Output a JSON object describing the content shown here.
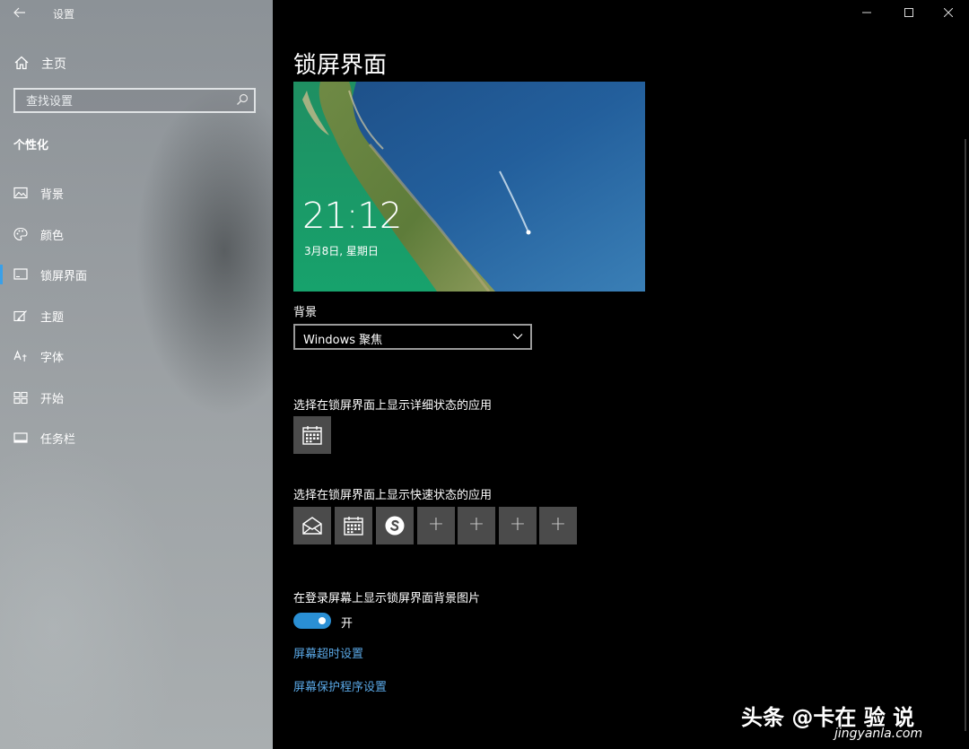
{
  "window": {
    "title": "设置",
    "controls": [
      "minimize-icon",
      "maximize-icon",
      "close-icon"
    ]
  },
  "sidebar": {
    "home_label": "主页",
    "search": {
      "placeholder": "查找设置"
    },
    "section_title": "个性化",
    "items": [
      {
        "label": "背景",
        "icon": "picture-icon",
        "selected": false
      },
      {
        "label": "颜色",
        "icon": "palette-icon",
        "selected": false
      },
      {
        "label": "锁屏界面",
        "icon": "lock-screen-icon",
        "selected": true
      },
      {
        "label": "主题",
        "icon": "theme-brush-icon",
        "selected": false
      },
      {
        "label": "字体",
        "icon": "font-icon",
        "selected": false
      },
      {
        "label": "开始",
        "icon": "start-grid-icon",
        "selected": false
      },
      {
        "label": "任务栏",
        "icon": "taskbar-icon",
        "selected": false
      }
    ]
  },
  "main": {
    "title": "锁屏界面",
    "preview": {
      "time": "21:12",
      "date": "3月8日, 星期日"
    },
    "background_label": "背景",
    "background_value": "Windows 聚焦",
    "detailed_status_label": "选择在锁屏界面上显示详细状态的应用",
    "detailed_status_apps": [
      "calendar-icon"
    ],
    "quick_status_label": "选择在锁屏界面上显示快速状态的应用",
    "quick_status_apps": [
      "mail-icon",
      "calendar-icon",
      "skype-icon",
      "add-icon",
      "add-icon",
      "add-icon",
      "add-icon"
    ],
    "signin_bg_label": "在登录屏幕上显示锁屏界面背景图片",
    "signin_bg_state": "开",
    "signin_bg_on": true,
    "screen_timeout_link": "屏幕超时设置",
    "screensaver_link": "屏幕保护程序设置"
  },
  "watermark": {
    "text": "头条 @卡在 验 说",
    "site": "jingyanla.com"
  },
  "colors": {
    "accent": "#2a8fd4",
    "link": "#5aa8e6",
    "selection_bar": "#3aa0e8",
    "tile": "#4b4b4b"
  }
}
